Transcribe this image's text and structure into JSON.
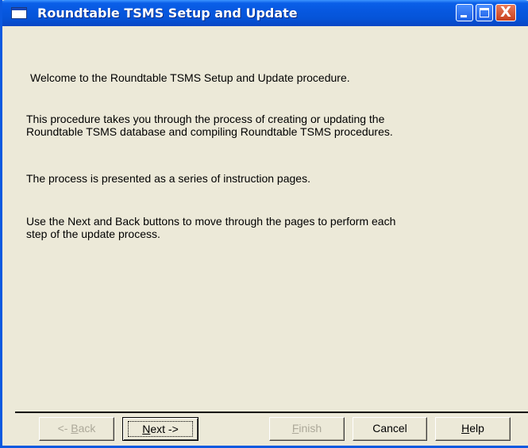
{
  "window": {
    "title": "Roundtable TSMS Setup and Update"
  },
  "titlebar_buttons": {
    "minimize": "minimize",
    "maximize": "maximize",
    "close": "X"
  },
  "content": {
    "welcome": "Welcome to the Roundtable TSMS Setup and Update procedure.",
    "paragraph_1": "This procedure takes you through the process of creating or updating the\nRoundtable TSMS database and compiling Roundtable TSMS procedures.",
    "paragraph_2": "The process is presented as a series of instruction pages.",
    "paragraph_3": "Use the Next and Back buttons to move through the pages to perform each\nstep of the update process."
  },
  "buttons": {
    "back": {
      "prefix": "<- ",
      "mnemonic": "B",
      "rest": "ack",
      "enabled": false
    },
    "next": {
      "mnemonic": "N",
      "rest": "ext ->",
      "enabled": true
    },
    "finish": {
      "mnemonic": "F",
      "rest": "inish",
      "enabled": false
    },
    "cancel": {
      "label": "Cancel",
      "enabled": true
    },
    "help": {
      "mnemonic": "H",
      "rest": "elp",
      "enabled": true
    }
  },
  "colors": {
    "titlebar": "#0554d8",
    "window_background": "#ece9d8",
    "disabled_text": "#aca899"
  }
}
